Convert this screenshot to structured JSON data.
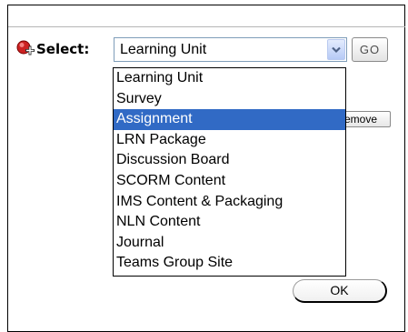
{
  "select": {
    "label": "Select:",
    "current_value": "Learning Unit",
    "go_label": "GO"
  },
  "dropdown": {
    "selected_index": 2,
    "options": [
      "Learning Unit",
      "Survey",
      "Assignment",
      "LRN Package",
      "Discussion Board",
      "SCORM Content",
      "IMS Content & Packaging",
      "NLN Content",
      "Journal",
      "Teams Group Site"
    ]
  },
  "remove_label": "emove",
  "ok_label": "OK",
  "colors": {
    "selection": "#316ac5",
    "combo_border": "#7f9db9"
  },
  "icons": {
    "add": "red-plus-icon",
    "dropdown_arrow": "chevron-down-icon"
  }
}
